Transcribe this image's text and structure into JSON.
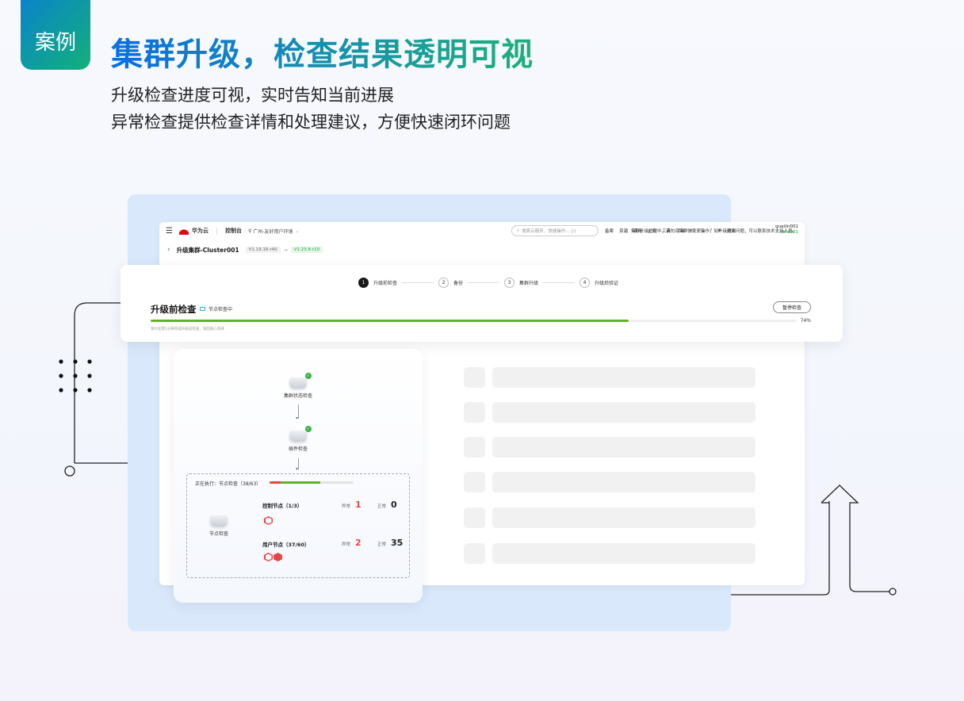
{
  "tag": "案例",
  "headline": "集群升级，检查结果透明可视",
  "sub1": "升级检查进度可视，实时告知当前进展",
  "sub2": "异常检查提供检查详情和处理建议，方便快速闭环问题",
  "topbar": {
    "brand": "华为云",
    "console": "控制台",
    "region": "广州-友好用户环境",
    "search_placeholder": "搜索云服务、快捷操作... (/)",
    "nav": [
      "备案",
      "资源",
      "费用",
      "企业",
      "工具",
      "工单"
    ],
    "lang": "简体",
    "user": "guailin001",
    "account": "dere001"
  },
  "subbar": {
    "title": "升级集群-Cluster001",
    "from_version": "V1.19.16-r40",
    "to_version": "V1.23.8-r10",
    "notice": "集群升级过程中，请勿对集群做变更操作，如升级遇到问题，可以联系技术支持人员。"
  },
  "steps": [
    {
      "num": "1",
      "label": "升级前检查"
    },
    {
      "num": "2",
      "label": "备份"
    },
    {
      "num": "3",
      "label": "集群升级"
    },
    {
      "num": "4",
      "label": "升级后验证"
    }
  ],
  "check": {
    "title": "升级前检查",
    "status": "节点检查中",
    "pause": "暂停检查",
    "progress": 74,
    "progress_label": "74%",
    "hint": "预计还需1分钟完成升级前检查，请您耐心等待"
  },
  "flow": {
    "node1": "集群状态检查",
    "node2": "插件检查",
    "running": "正在执行：节点检查（38/63）",
    "mini_red": 0.13,
    "mini_green": 0.6,
    "node3": "节点检查",
    "rows": [
      {
        "label": "控制节点（1/3）",
        "abnormal_label": "异常",
        "abnormal": "1",
        "normal_label": "正常",
        "normal": "0"
      },
      {
        "label": "用户节点（37/60）",
        "abnormal_label": "异常",
        "abnormal": "2",
        "normal_label": "正常",
        "normal": "35"
      }
    ]
  },
  "colors": {
    "accent_green": "#63b225",
    "alert_red": "#e84545",
    "brand_gradient_start": "#0b6fe0",
    "brand_gradient_end": "#1fb07a"
  }
}
